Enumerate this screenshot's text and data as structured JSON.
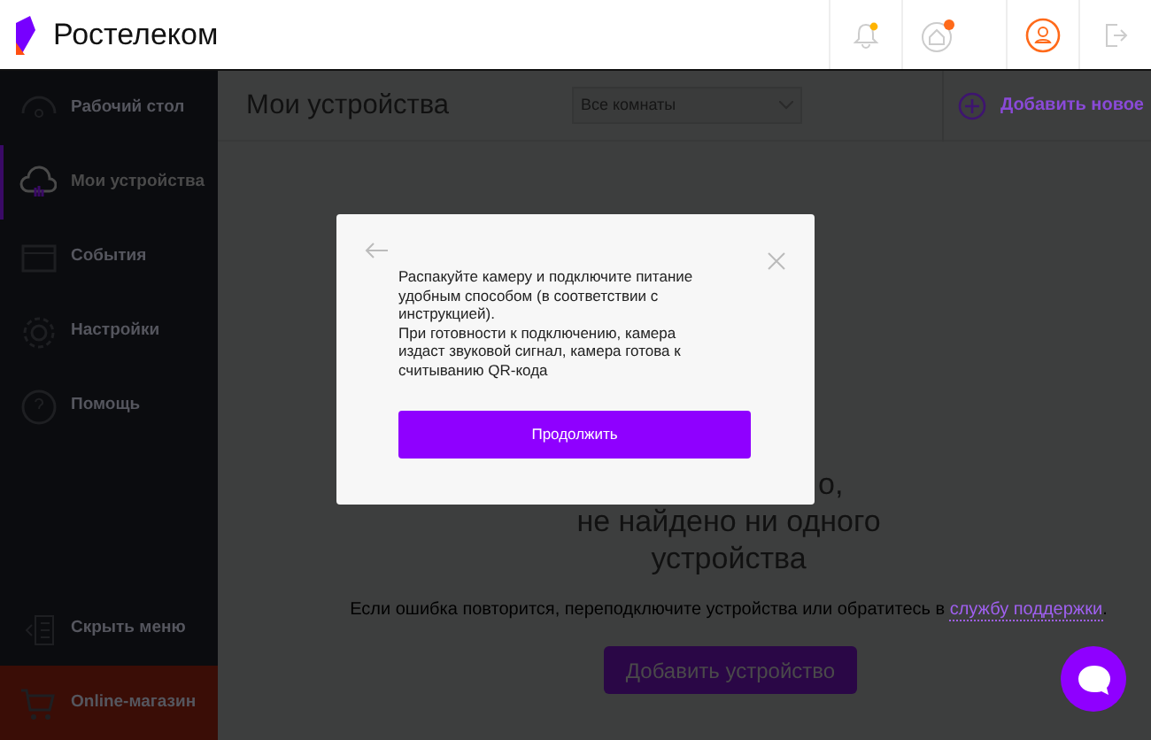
{
  "header": {
    "logo": "Ростелеком",
    "notification_dot": true,
    "home_badge": true
  },
  "sidebar": {
    "items": [
      {
        "label": "Рабочий стол",
        "selected": false
      },
      {
        "label": "Мои устройства",
        "selected": true
      },
      {
        "label": "События",
        "selected": false
      },
      {
        "label": "Настройки",
        "selected": false
      },
      {
        "label": "Помощь",
        "selected": false
      }
    ],
    "bottom": [
      {
        "kind": "collapse",
        "label": "Скрыть меню"
      },
      {
        "kind": "shop",
        "label": "Online-магазин"
      }
    ]
  },
  "topbar": {
    "title": "Мои устройства",
    "room_select": "Все комнаты",
    "add_new": "Добавить новое"
  },
  "empty_state": {
    "heading_lines": [
      "о,",
      "не найдено ни одного",
      "устройства"
    ],
    "hint": "Если ошибка повторится, переподключите устройства или обратитесь в",
    "support_link": "службу поддержки",
    "hint_end": ".",
    "button": "Добавить устройство"
  },
  "modal": {
    "text_lines": [
      "Распакуйте камеру и подключите питание удобным способом (в соответствии с инструкцией).",
      "При готовности к подключению, камера издаст звуковой сигнал, камера готова к считыванию QR-кода"
    ],
    "button": "Продолжить"
  }
}
